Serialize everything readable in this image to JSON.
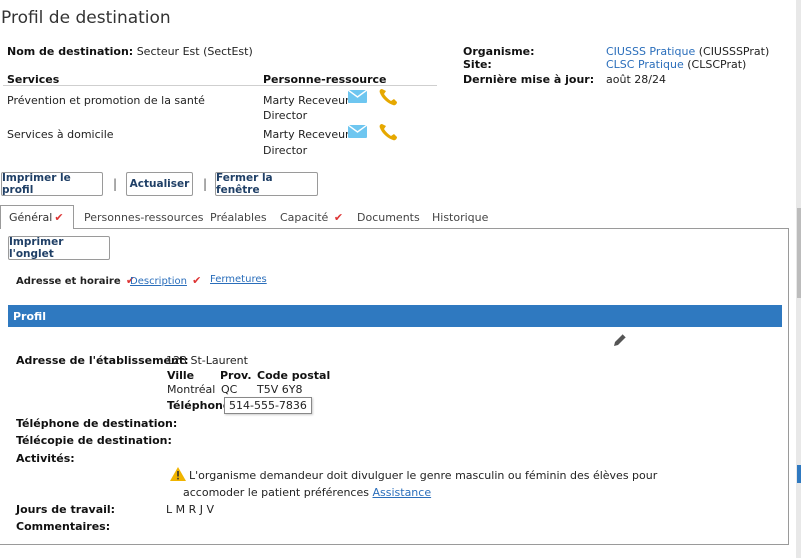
{
  "page": {
    "title": "Profil de destination"
  },
  "summary": {
    "dest_name_label": "Nom de destination:",
    "dest_name_value": "Secteur Est (SectEst)",
    "org_label": "Organisme:",
    "org_link": "CIUSSS Pratique",
    "org_code": "(CIUSSSPrat)",
    "site_label": "Site:",
    "site_link": "CLSC Pratique",
    "site_code": "(CLSCPrat)",
    "updated_label": "Dernière mise à jour:",
    "updated_value": "août 28/24"
  },
  "services": {
    "col_services": "Services",
    "col_contact": "Personne-ressource",
    "rows": [
      {
        "service": "Prévention et promotion de la santé",
        "contact": "Marty Receveur",
        "role": "Director"
      },
      {
        "service": "Services à domicile",
        "contact": "Marty Receveur",
        "role": "Director"
      }
    ]
  },
  "toolbar": {
    "print_profile": "Imprimer le profil",
    "separator": "|",
    "refresh": "Actualiser",
    "close_window": "Fermer la fenêtre"
  },
  "tabs": [
    {
      "label": "Général",
      "checked": true
    },
    {
      "label": "Personnes-ressources",
      "checked": false
    },
    {
      "label": "Préalables",
      "checked": false
    },
    {
      "label": "Capacité",
      "checked": true
    },
    {
      "label": "Documents",
      "checked": false
    },
    {
      "label": "Historique",
      "checked": false
    }
  ],
  "check_mark": "✔",
  "panel": {
    "print_tab": "Imprimer l'onglet",
    "subtabs": [
      {
        "label": "Adresse et horaire",
        "checked": true
      },
      {
        "label": "Description",
        "checked": true
      },
      {
        "label": "Fermetures",
        "checked": false
      }
    ]
  },
  "profile": {
    "section_title": "Profil",
    "address_label": "Adresse de l'établissement:",
    "address_value": "123 St-Laurent",
    "city_header": "Ville",
    "prov_header": "Prov.",
    "postal_header": "Code postal",
    "city": "Montréal",
    "prov": "QC",
    "postal": "T5V 6Y8",
    "phone_label": "Téléphone:",
    "phone_value": "514-555-7836",
    "dest_phone_label": "Téléphone de destination:",
    "fax_label": "Télécopie de destination:",
    "activities_label": "Activités:",
    "warning_text_1": "L'organisme demandeur doit divulguer le genre masculin ou féminin des élèves pour",
    "warning_text_2": "accomoder le patient préférences",
    "warning_link": "Assistance",
    "workdays_label": "Jours de travail:",
    "workdays_value": "L M R J V",
    "comments_label": "Commentaires:"
  },
  "colors": {
    "accent": "#2f79c0",
    "link": "#2a6ebb",
    "check": "#dd3333",
    "phone_icon": "#e6a800",
    "mail_icon": "#6ec6f0",
    "warning": "#f0b400"
  }
}
